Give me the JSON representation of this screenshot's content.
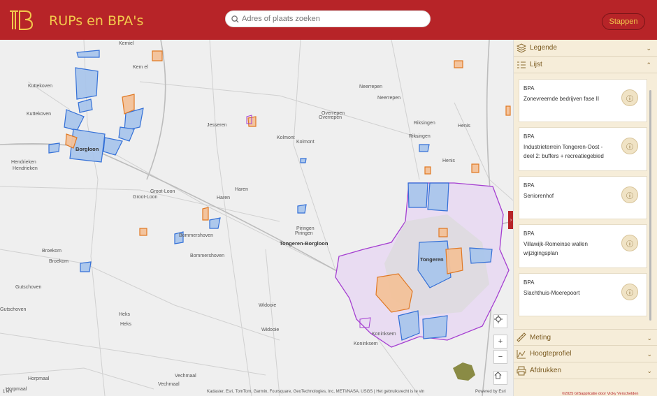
{
  "header": {
    "title": "RUPs en BPA's",
    "search_placeholder": "Adres of plaats zoeken",
    "steps_label": "Stappen"
  },
  "panel": {
    "legend_label": "Legende",
    "list_label": "Lijst",
    "items": [
      {
        "type": "BPA",
        "name": "Zonevreemde bedrijven fase II"
      },
      {
        "type": "BPA",
        "name": "Industrieterrein Tongeren-Oost - deel 2: buffers + recreatiegebied"
      },
      {
        "type": "BPA",
        "name": "Seniorenhof"
      },
      {
        "type": "BPA",
        "name": "Villawijk-Romeinse wallen wijzigingsplan"
      },
      {
        "type": "BPA",
        "name": "Slachthuis-Moerepoort"
      }
    ],
    "measure_label": "Meting",
    "profile_label": "Hoogteprofiel",
    "print_label": "Afdrukken",
    "footer": "©2025 GISapplicatie door Vicky Verschelden"
  },
  "map": {
    "labels": [
      "Kemiel",
      "Kem el",
      "Kuttekoven",
      "Kuttekoven",
      "Borgloon",
      "Hendrieken",
      "Hendrieken",
      "Groot-Loon",
      "Groot-Loon",
      "Jesseren",
      "Kolmont",
      "Kolmont",
      "Neerrepen",
      "Neerrepen",
      "Overrepen",
      "Overrepen",
      "Riksingen",
      "Riksingen",
      "Henis",
      "Henis",
      "Haren",
      "Haren",
      "Piringen",
      "Piringen",
      "Tongeren-Borgloon",
      "Bommershoven",
      "Bommershoven",
      "Broekom",
      "Broekom",
      "Gutschoven",
      "Gutschoven",
      "Heks",
      "Heks",
      "Widooie",
      "Widooie",
      "Tongeren",
      "Koninksem",
      "Koninksem",
      "Vechmaal",
      "Vechmaal",
      "Horpmaal",
      "Horpmaal"
    ],
    "attribution": "Kadaster, Esri, TomTom, Garmin, Foursquare, GeoTechnologies, Inc, METI/NASA, USGS | Het gebruiksrecht is te vin",
    "scale": "1 km",
    "powered": "Powered by Esri",
    "zoom_in": "+",
    "zoom_out": "−"
  }
}
